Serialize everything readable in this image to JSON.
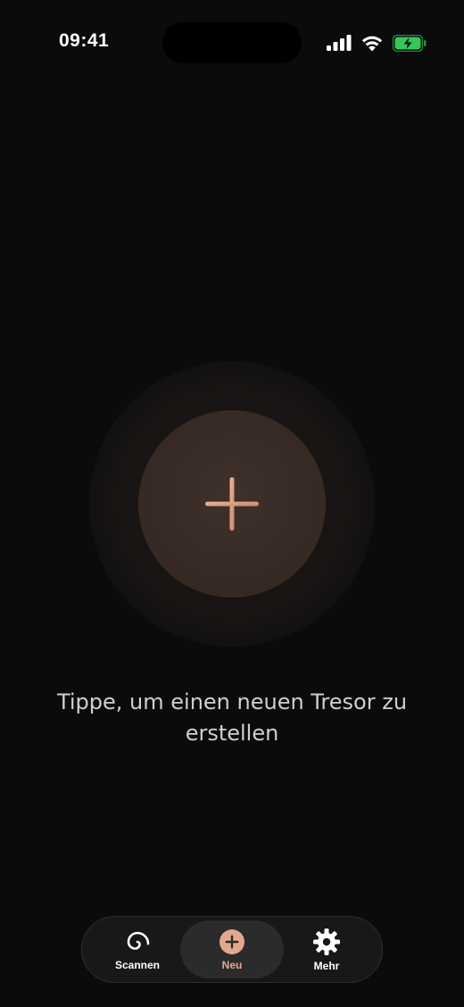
{
  "status_bar": {
    "time": "09:41",
    "icons": [
      "cellular-signal-icon",
      "wifi-icon",
      "battery-charging-icon"
    ],
    "battery_color": "#34c759"
  },
  "main": {
    "add_button_icon": "plus-icon",
    "hint": "Tippe, um einen neuen Tresor zu erstellen",
    "accent_color": "#e3a98e"
  },
  "tab_bar": {
    "tabs": [
      {
        "label": "Scannen",
        "icon": "spiral-icon",
        "active": false
      },
      {
        "label": "Neu",
        "icon": "plus-circle-icon",
        "active": true
      },
      {
        "label": "Mehr",
        "icon": "gear-icon",
        "active": false
      }
    ]
  }
}
